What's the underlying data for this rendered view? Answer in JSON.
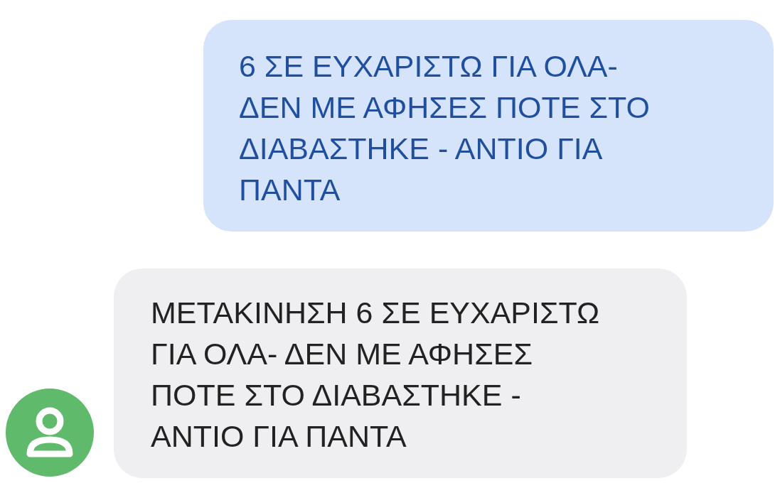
{
  "messages": [
    {
      "kind": "sent",
      "text": "6 ΣΕ ΕΥΧΑΡΙΣΤΩ ΓΙΑ ΟΛΑ-\nΔΕΝ ΜΕ ΑΦΗΣΕΣ ΠΟΤΕ ΣΤΟ\nΔΙΑΒΑΣΤΗΚΕ - ΑΝΤΙΟ ΓΙΑ\nΠΑΝΤΑ"
    },
    {
      "kind": "received",
      "text": "ΜΕΤΑΚΙΝΗΣΗ 6 ΣΕ ΕΥΧΑΡΙΣΤΩ\nΓΙΑ ΟΛΑ- ΔΕΝ ΜΕ ΑΦΗΣΕΣ\nΠΟΤΕ ΣΤΟ ΔΙΑΒΑΣΤΗΚΕ -\nΑΝΤΙΟ ΓΙΑ ΠΑΝΤΑ",
      "color": "#5fba6b"
    }
  ]
}
